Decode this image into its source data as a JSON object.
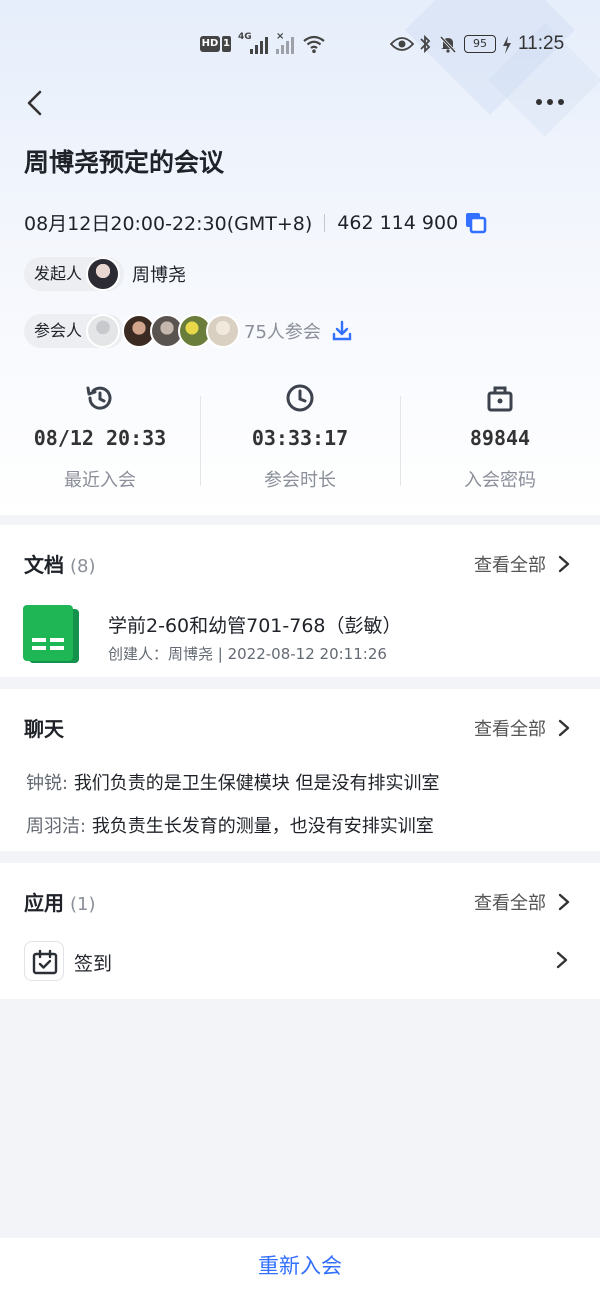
{
  "status_bar": {
    "hd": "HD",
    "sim": "1",
    "network": "4G",
    "battery": "95",
    "time": "11:25"
  },
  "meeting": {
    "title": "周博尧预定的会议",
    "time_range": "08月12日20:00-22:30(GMT+8)",
    "meeting_id": "462 114 900",
    "organizer_label": "发起人",
    "organizer_name": "周博尧",
    "attendees_label": "参会人",
    "attendee_count": "75人参会"
  },
  "stats": [
    {
      "icon": "history-clock-icon",
      "value": "08/12 20:33",
      "label": "最近入会"
    },
    {
      "icon": "clock-icon",
      "value": "03:33:17",
      "label": "参会时长"
    },
    {
      "icon": "lock-icon",
      "value": "89844",
      "label": "入会密码"
    }
  ],
  "documents": {
    "title": "文档",
    "count": "(8)",
    "view_all": "查看全部",
    "items": [
      {
        "icon": "spreadsheet-icon",
        "name": "学前2-60和幼管701-768（彭敏）",
        "meta": "创建人：周博尧 | 2022-08-12 20:11:26"
      }
    ]
  },
  "chat": {
    "title": "聊天",
    "view_all": "查看全部",
    "messages": [
      {
        "sender": "钟锐:",
        "text": "我们负责的是卫生保健模块 但是没有排实训室"
      },
      {
        "sender": "周羽洁:",
        "text": "我负责生长发育的测量，也没有安排实训室"
      }
    ]
  },
  "apps": {
    "title": "应用",
    "count": "(1)",
    "view_all": "查看全部",
    "items": [
      {
        "icon": "calendar-check-icon",
        "label": "签到"
      }
    ]
  },
  "footer": {
    "rejoin_label": "重新入会"
  },
  "colors": {
    "accent": "#3370ff",
    "sheet_green": "#1fb755"
  }
}
